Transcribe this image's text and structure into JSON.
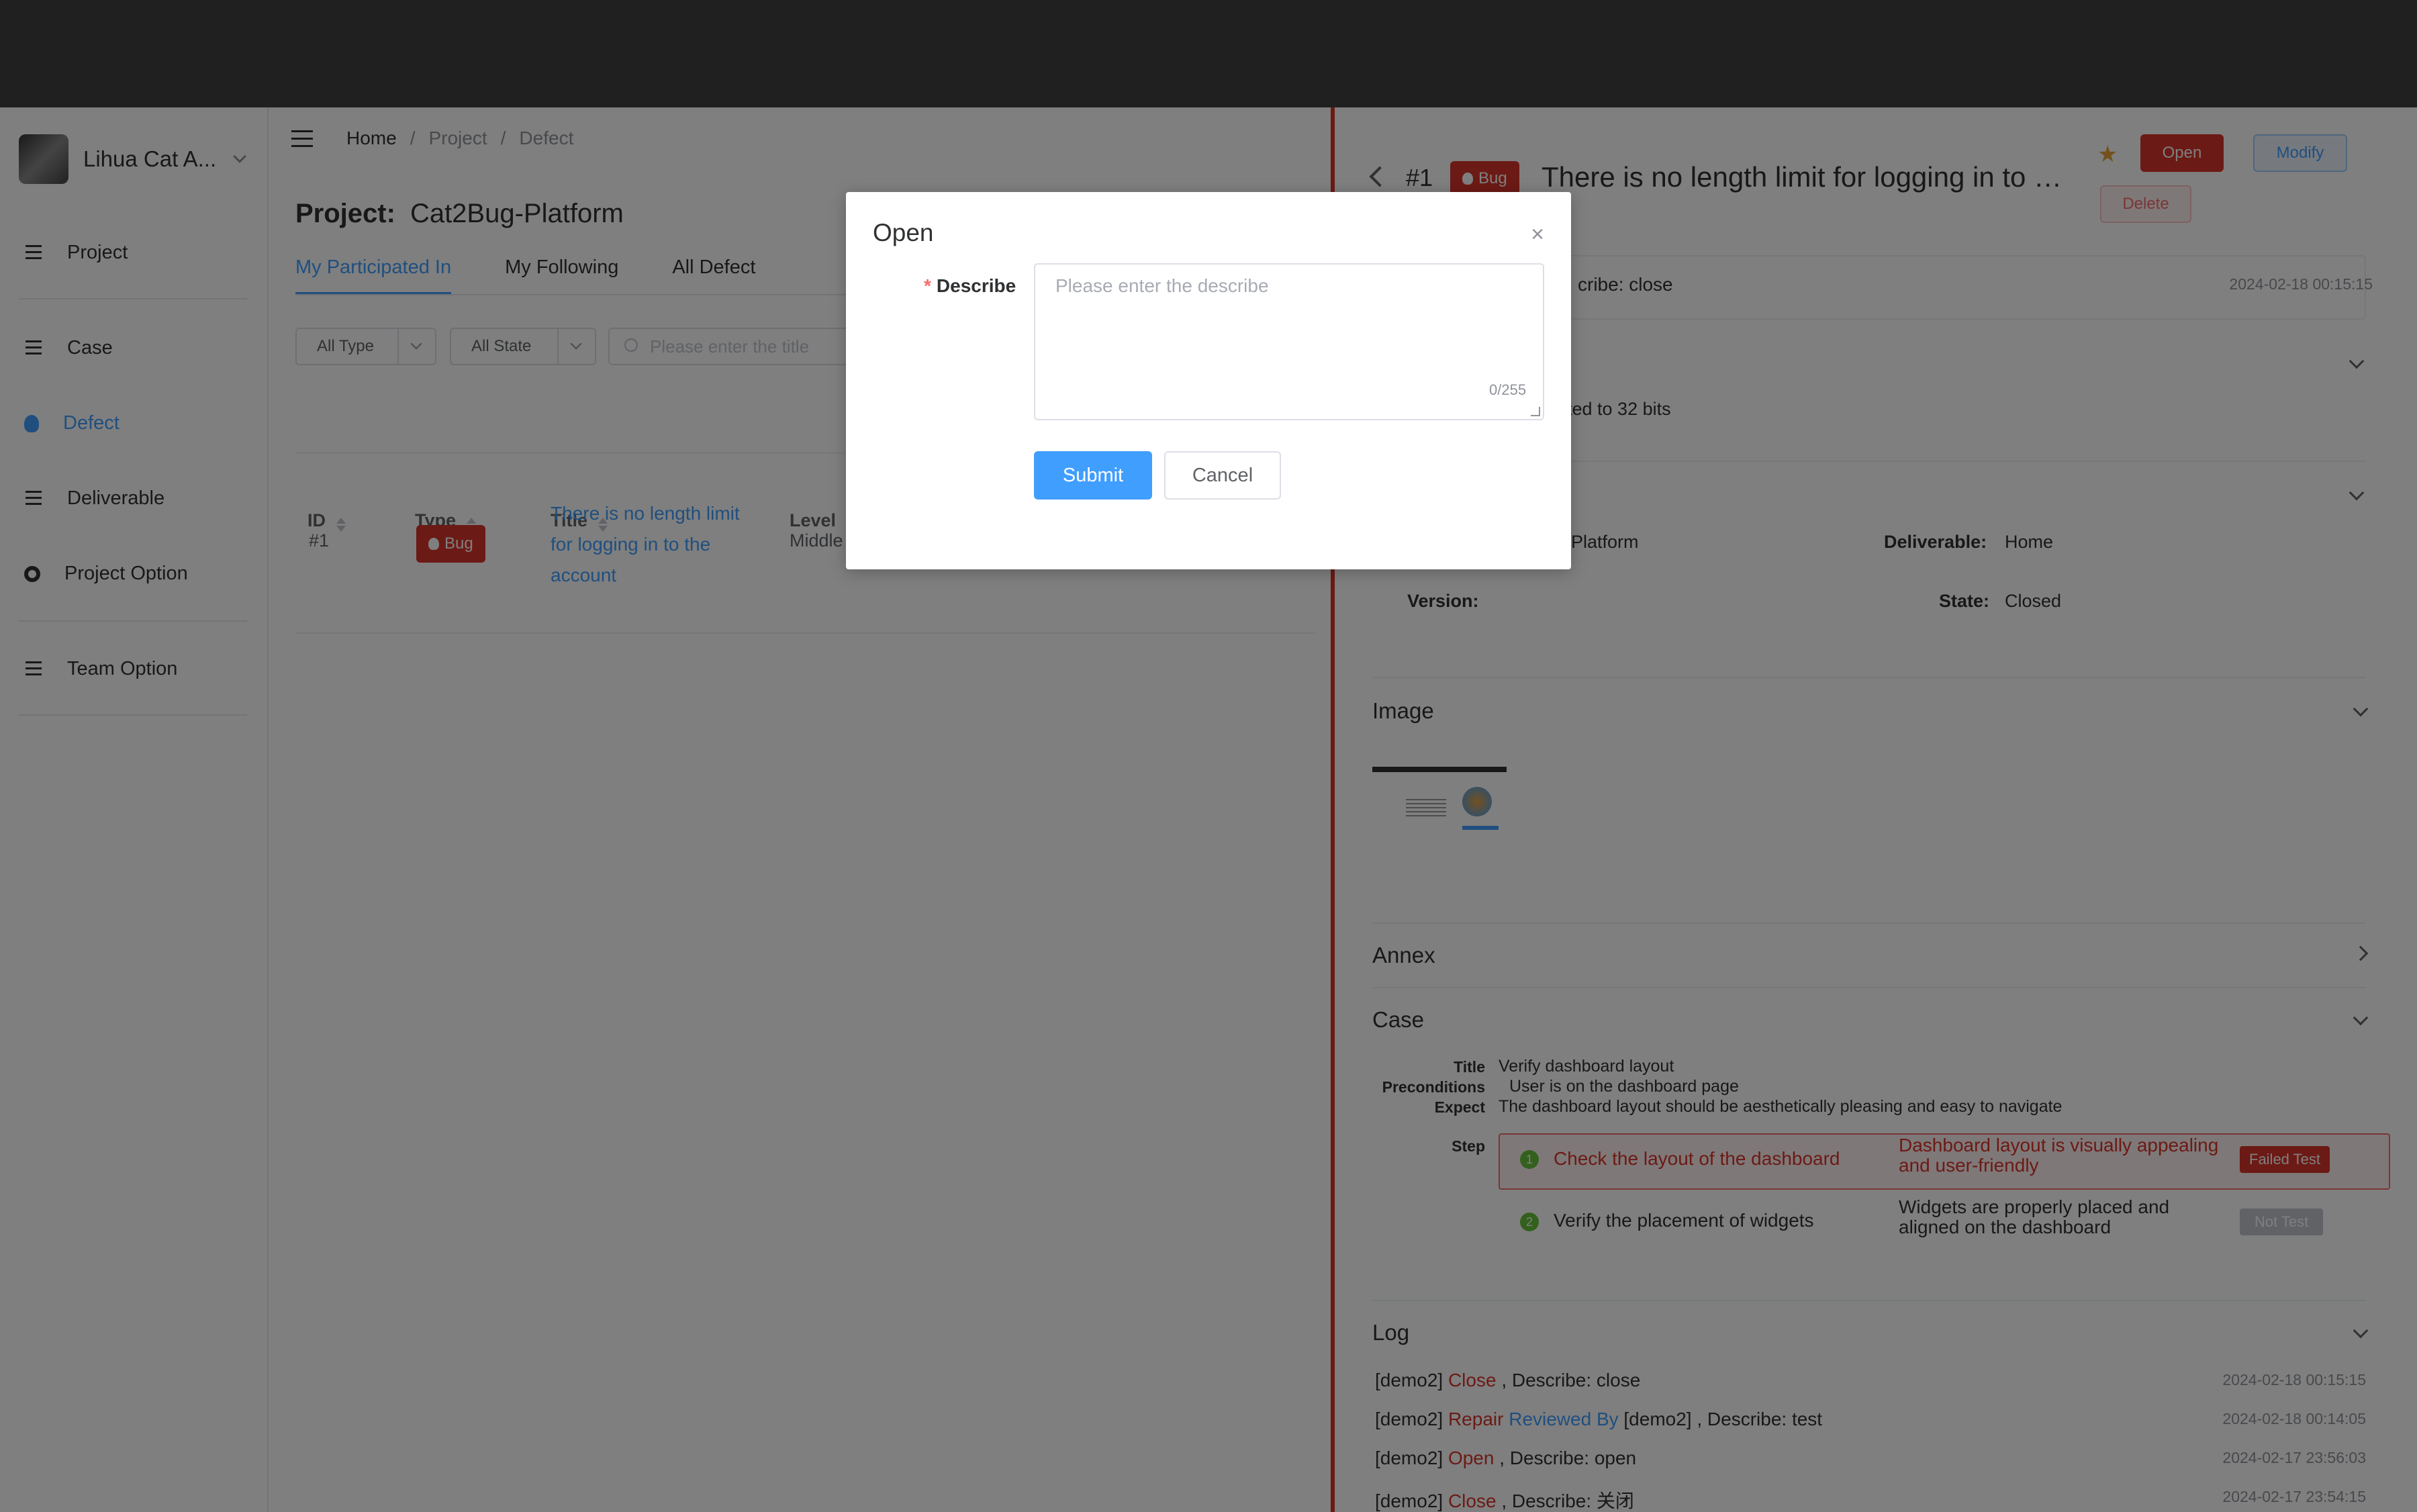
{
  "sidebar": {
    "team": "Lihua Cat A...",
    "items": [
      {
        "label": "Project",
        "icon": "list-icon"
      },
      {
        "label": "Case",
        "icon": "case-list-icon"
      },
      {
        "label": "Defect",
        "icon": "bug-icon"
      },
      {
        "label": "Deliverable",
        "icon": "deliverable-icon"
      },
      {
        "label": "Project Option",
        "icon": "gear-icon"
      },
      {
        "label": "Team Option",
        "icon": "team-option-icon"
      }
    ]
  },
  "breadcrumb": [
    "Home",
    "/",
    "Project",
    "/",
    "Defect"
  ],
  "project": {
    "label": "Project:",
    "name": "Cat2Bug-Platform"
  },
  "tabs": [
    "My Participated In",
    "My Following",
    "All Defect"
  ],
  "filters": {
    "type": "All Type",
    "state": "All State",
    "search_placeholder": "Please enter the title"
  },
  "table": {
    "headers": [
      "ID",
      "Type",
      "Title",
      "Level"
    ],
    "rows": [
      {
        "id": "#1",
        "type": "Bug",
        "title": "There is no length limit for logging in to the account",
        "level": "Middle"
      }
    ]
  },
  "drawer": {
    "id": "#1",
    "type": "Bug",
    "title": "There is no length limit for logging in to the account",
    "buttons": {
      "open": "Open",
      "modify": "Modify",
      "delete": "Delete"
    },
    "latest": {
      "text": "cribe: close",
      "time": "2024-02-18 00:15:15"
    },
    "describe_text": "ted to 32 bits",
    "info": {
      "project_value": "Platform",
      "deliverable_label": "Deliverable:",
      "deliverable_value": "Home",
      "version_label": "Version:",
      "state_label": "State:",
      "state_value": "Closed"
    },
    "sections": {
      "image": "Image",
      "annex": "Annex",
      "case": "Case",
      "log": "Log"
    },
    "case": {
      "title_label": "Title",
      "title": "Verify dashboard layout",
      "pre_label": "Preconditions",
      "pre": "User is on the dashboard page",
      "expect_label": "Expect",
      "expect": "The dashboard layout should be aesthetically pleasing and easy to navigate",
      "step_label": "Step",
      "steps": [
        {
          "num": "1",
          "text": "Check the layout of the dashboard",
          "expect_line1": "Dashboard layout is visually appealing",
          "expect_line2": "and user-friendly",
          "status": "Failed Test"
        },
        {
          "num": "2",
          "text": "Verify the placement of widgets",
          "expect_line1": "Widgets are properly placed and",
          "expect_line2": "aligned on the dashboard",
          "status": "Not Test"
        }
      ]
    },
    "log": [
      {
        "user": "[demo2]",
        "action": "Close",
        "rest": ", Describe: close",
        "time": "2024-02-18 00:15:15"
      },
      {
        "user": "[demo2]",
        "action": "Repair",
        "mid": "Reviewed By",
        "rest": "[demo2] , Describe: test",
        "time": "2024-02-18 00:14:05"
      },
      {
        "user": "[demo2]",
        "action": "Open",
        "rest": ", Describe: open",
        "time": "2024-02-17 23:56:03"
      },
      {
        "user": "[demo2]",
        "action": "Close",
        "rest": ", Describe: 关闭",
        "time": "2024-02-17 23:54:15"
      }
    ]
  },
  "modal": {
    "title": "Open",
    "close": "×",
    "required_mark": "*",
    "label": "Describe",
    "placeholder": "Please enter the describe",
    "count": "0/255",
    "submit": "Submit",
    "cancel": "Cancel"
  },
  "colors": {
    "accent": "#409eff",
    "danger": "#d9342b",
    "success": "#67c23a"
  }
}
